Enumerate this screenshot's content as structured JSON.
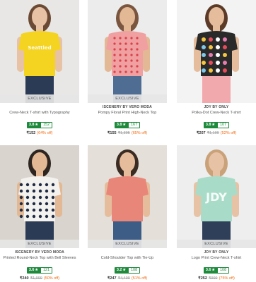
{
  "products": [
    {
      "badge": "EXCLUSIVE",
      "brand": "",
      "name": "Crew-Neck T-shirt with Typography",
      "rating": "3.8",
      "reviews": "152",
      "price": "₹152",
      "mrp": "",
      "discount": "(64% off)",
      "shirt_print": "Seattled",
      "colors": {
        "bg": "#e9e7e5",
        "top": "#f4d420",
        "bottom": "#2b3a55",
        "skin": "#e8c2a4",
        "hair": "#6b4a35"
      }
    },
    {
      "badge": "EXCLUSIVE",
      "brand": "ISCENERY BY VERO MODA",
      "name": "Pompy Floral Print High-Neck Top",
      "rating": "3.8",
      "reviews": "167",
      "price": "₹155",
      "mrp": "₹1,395",
      "discount": "(65% off)",
      "shirt_print": "",
      "colors": {
        "bg": "#ececec",
        "top": "#f0a0a0",
        "bottom": "#4f6d93",
        "skin": "#e3b894",
        "hair": "#7a5640"
      }
    },
    {
      "badge": "",
      "brand": "JDY BY ONLY",
      "name": "Polka-Dot Crew-Neck T-shirt",
      "rating": "3.8",
      "reviews": "107",
      "price": "₹207",
      "mrp": "₹1,199",
      "discount": "(52% off)",
      "shirt_print": "",
      "colors": {
        "bg": "#f3f3f3",
        "top": "#2a2a2a",
        "bottom": "#f2a9ad",
        "skin": "#e6bd9c",
        "hair": "#5b3b28"
      }
    },
    {
      "badge": "EXCLUSIVE",
      "brand": "ISCENERY BY VERO MODA",
      "name": "Printed Round-Neck Top with Bell Sleeves",
      "rating": "3.6",
      "reviews": "121",
      "price": "₹240",
      "mrp": "₹1,999",
      "discount": "(50% off)",
      "shirt_print": "",
      "colors": {
        "bg": "#d9d4cd",
        "top": "#f4f2ee",
        "bottom": "#2b3a55",
        "skin": "#e3b894",
        "hair": "#2e2520"
      }
    },
    {
      "badge": "EXCLUSIVE",
      "brand": "",
      "name": "Cold-Shoulder Top with Tie-Up",
      "rating": "3.2",
      "reviews": "108",
      "price": "₹247",
      "mrp": "₹4,499",
      "discount": "(51% off)",
      "shirt_print": "",
      "colors": {
        "bg": "#e4e0d9",
        "top": "#e88779",
        "bottom": "#3e5d86",
        "skin": "#e6bd9c",
        "hair": "#3a2c22"
      }
    },
    {
      "badge": "EXCLUSIVE",
      "brand": "JDY BY ONLY",
      "name": "Logo Print Crew-Neck T-shirt",
      "rating": "3.6",
      "reviews": "108",
      "price": "₹252",
      "mrp": "₹999",
      "discount": "(75% off)",
      "shirt_print": "JDY",
      "colors": {
        "bg": "#eeeeee",
        "top": "#a8dcc8",
        "bottom": "#2f3f5a",
        "skin": "#e8c2a4",
        "hair": "#c9a27a"
      }
    }
  ]
}
